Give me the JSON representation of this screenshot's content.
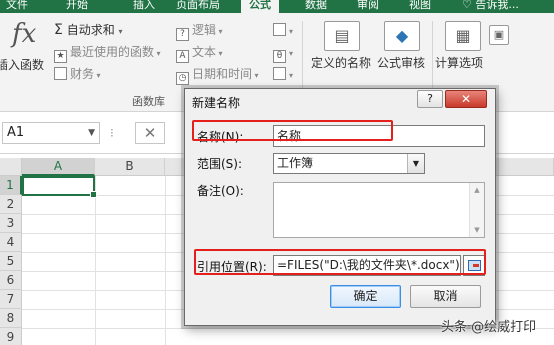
{
  "ribbon_tabs": [
    "文件",
    "开始",
    "插入",
    "页面布局",
    "公式",
    "数据",
    "审阅",
    "视图",
    "告诉我..."
  ],
  "active_tab_index": 4,
  "ribbon": {
    "insert_function": "插入函数",
    "autosum": "自动求和",
    "recent": "最近使用的函数",
    "financial": "财务",
    "logical": "逻辑",
    "text": "文本",
    "datetime": "日期和时间",
    "library_group": "函数库",
    "define_name": "定义的名称",
    "formula_audit": "公式审核",
    "calc_options": "计算选项"
  },
  "formula_bar": {
    "name_box": "A1",
    "cancel_symbol": "✕"
  },
  "grid": {
    "columns": [
      "A",
      "B"
    ],
    "rows": [
      "1",
      "2",
      "3",
      "4",
      "5",
      "6",
      "7",
      "8",
      "9"
    ],
    "active_cell": "A1"
  },
  "dialog": {
    "title": "新建名称",
    "help": "?",
    "close": "✕",
    "name_label": "名称(N):",
    "name_value": "名称",
    "scope_label": "范围(S):",
    "scope_value": "工作簿",
    "comment_label": "备注(O):",
    "comment_value": "",
    "refers_label": "引用位置(R):",
    "refers_value": "=FILES(\"D:\\我的文件夹\\*.docx\")",
    "ok": "确定",
    "cancel": "取消"
  },
  "watermark": "头条 @绘威打印",
  "colors": {
    "excel_green": "#217346",
    "highlight_red": "#e5201c"
  }
}
